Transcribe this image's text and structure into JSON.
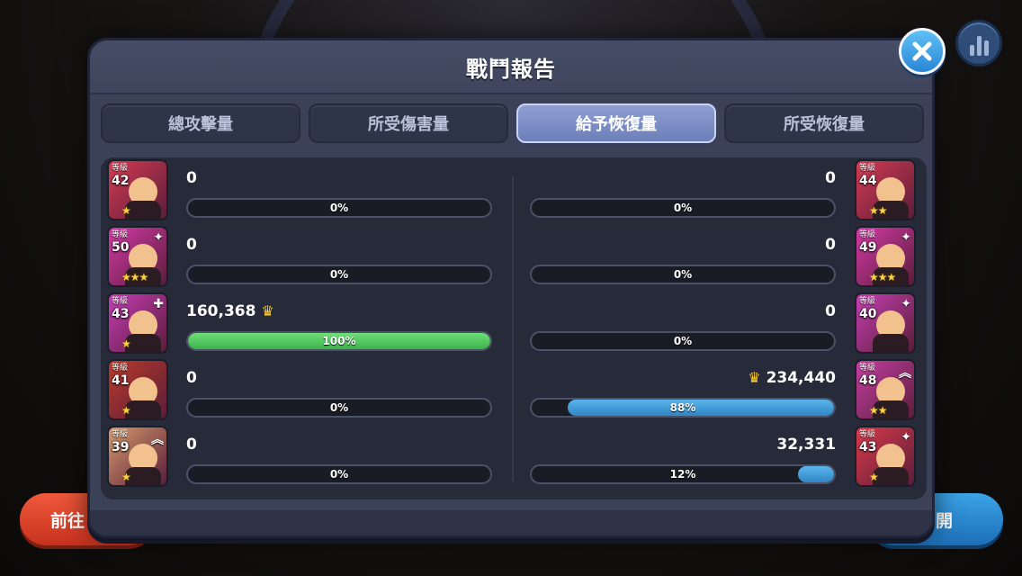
{
  "title": "戰鬥報告",
  "tabs": [
    {
      "label": "總攻擊量",
      "active": false
    },
    {
      "label": "所受傷害量",
      "active": false
    },
    {
      "label": "給予恢復量",
      "active": true
    },
    {
      "label": "所受恢復量",
      "active": false
    }
  ],
  "background_buttons": {
    "left_label": "前往",
    "right_label": "開"
  },
  "level_tag": "等級",
  "left_team": [
    {
      "level": "42",
      "stars": "★",
      "value": "0",
      "percent": "0%",
      "fill": 0,
      "crown": false,
      "color": "#d43b52",
      "badge": ""
    },
    {
      "level": "50",
      "stars": "★★★",
      "value": "0",
      "percent": "0%",
      "fill": 0,
      "crown": false,
      "color": "#d23aa6",
      "badge": "✦"
    },
    {
      "level": "43",
      "stars": "★",
      "value": "160,368",
      "percent": "100%",
      "fill": 1.0,
      "crown": true,
      "color": "#c53cb4",
      "badge": "✚"
    },
    {
      "level": "41",
      "stars": "★",
      "value": "0",
      "percent": "0%",
      "fill": 0,
      "crown": false,
      "color": "#b83a2a",
      "badge": ""
    },
    {
      "level": "39",
      "stars": "★",
      "value": "0",
      "percent": "0%",
      "fill": 0,
      "crown": false,
      "color": "#d59a6c",
      "badge": "︽"
    }
  ],
  "right_team": [
    {
      "level": "44",
      "stars": "★★",
      "value": "0",
      "percent": "0%",
      "fill": 0,
      "crown": false,
      "color": "#d43b52",
      "badge": ""
    },
    {
      "level": "49",
      "stars": "★★★",
      "value": "0",
      "percent": "0%",
      "fill": 0,
      "crown": false,
      "color": "#d23aa6",
      "badge": "✦"
    },
    {
      "level": "40",
      "stars": "",
      "value": "0",
      "percent": "0%",
      "fill": 0,
      "crown": false,
      "color": "#c43fb0",
      "badge": "✦"
    },
    {
      "level": "48",
      "stars": "★★",
      "value": "234,440",
      "percent": "88%",
      "fill": 0.88,
      "crown": true,
      "color": "#c43fa2",
      "badge": "︽"
    },
    {
      "level": "43",
      "stars": "★",
      "value": "32,331",
      "percent": "12%",
      "fill": 0.12,
      "crown": false,
      "color": "#d83a4a",
      "badge": "✦"
    }
  ]
}
